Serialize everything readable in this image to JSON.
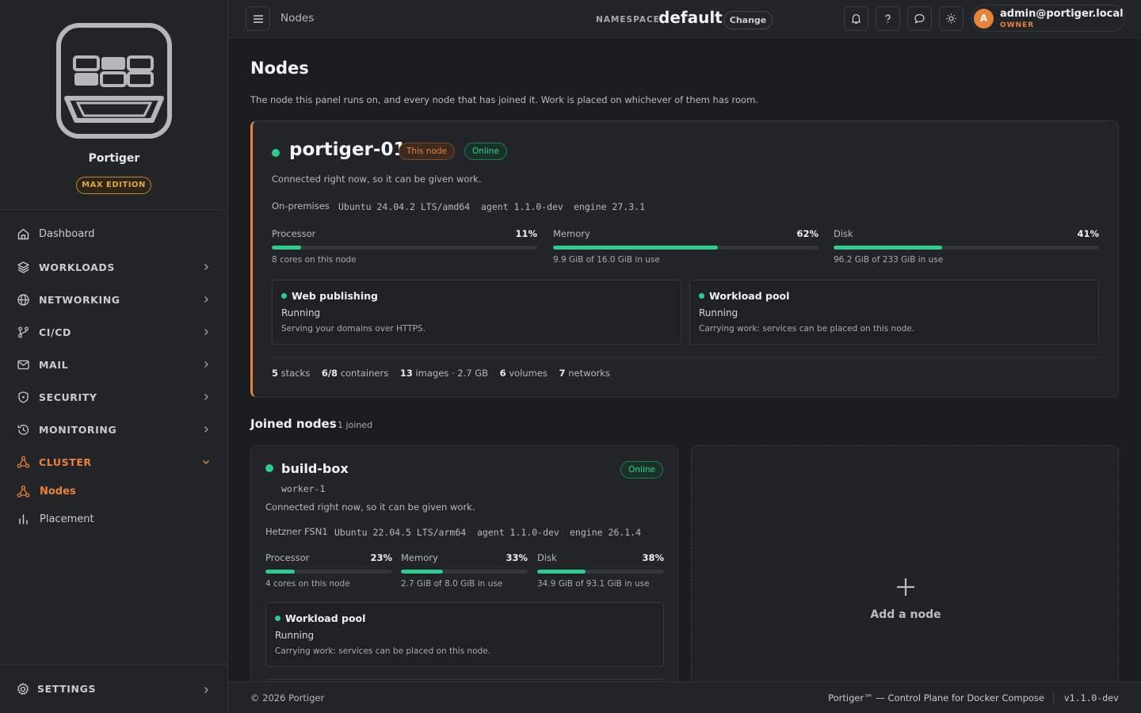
{
  "brand": {
    "name": "Portiger",
    "edition": "MAX EDITION"
  },
  "sidebar": {
    "dashboard": "Dashboard",
    "sections": [
      "WORKLOADS",
      "NETWORKING",
      "CI/CD",
      "MAIL",
      "SECURITY",
      "MONITORING"
    ],
    "cluster": "CLUSTER",
    "cluster_items": [
      "Nodes",
      "Placement"
    ],
    "settings": "SETTINGS"
  },
  "topbar": {
    "breadcrumb": "Nodes",
    "namespace_label": "NAMESPACE",
    "namespace_value": "default",
    "change_label": "Change",
    "user_initial": "A",
    "user_email": "admin@portiger.local",
    "user_role": "OWNER"
  },
  "page": {
    "title": "Nodes",
    "description": "The node this panel runs on, and every node that has joined it. Work is placed on whichever of them has room."
  },
  "local_node": {
    "name": "portiger-01",
    "this_badge": "This node",
    "status": "Online",
    "status_text": "Connected right now, so it can be given work.",
    "location": "On-premises",
    "os": "Ubuntu 24.04.2 LTS/amd64",
    "agent": "agent 1.1.0-dev",
    "engine": "engine 27.3.1",
    "resources": [
      {
        "label": "Processor",
        "pct_text": "11%",
        "pct": 11,
        "sub": "8 cores on this node"
      },
      {
        "label": "Memory",
        "pct_text": "62%",
        "pct": 62,
        "sub": "9.9 GiB of 16.0 GiB in use"
      },
      {
        "label": "Disk",
        "pct_text": "41%",
        "pct": 41,
        "sub": "96.2 GiB of 233 GiB in use"
      }
    ],
    "services": [
      {
        "title": "Web publishing",
        "state": "Running",
        "desc": "Serving your domains over HTTPS."
      },
      {
        "title": "Workload pool",
        "state": "Running",
        "desc": "Carrying work: services can be placed on this node."
      }
    ],
    "stats": {
      "stacks_n": "5",
      "stacks_l": "stacks",
      "containers_n": "6/8",
      "containers_l": "containers",
      "images_n": "13",
      "images_l": "images · 2.7 GB",
      "volumes_n": "6",
      "volumes_l": "volumes",
      "networks_n": "7",
      "networks_l": "networks"
    }
  },
  "joined": {
    "title": "Joined nodes",
    "count": "1 joined",
    "nodes": [
      {
        "name": "build-box",
        "role": "worker-1",
        "status": "Online",
        "status_text": "Connected right now, so it can be given work.",
        "location": "Hetzner FSN1",
        "os": "Ubuntu 22.04.5 LTS/arm64",
        "agent": "agent 1.1.0-dev",
        "engine": "engine 26.1.4",
        "resources": [
          {
            "label": "Processor",
            "pct_text": "23%",
            "pct": 23,
            "sub": "4 cores on this node"
          },
          {
            "label": "Memory",
            "pct_text": "33%",
            "pct": 33,
            "sub": "2.7 GiB of 8.0 GiB in use"
          },
          {
            "label": "Disk",
            "pct_text": "38%",
            "pct": 38,
            "sub": "34.9 GiB of 93.1 GiB in use"
          }
        ],
        "services": [
          {
            "title": "Workload pool",
            "state": "Running",
            "desc": "Carrying work: services can be placed on this node."
          }
        ]
      }
    ],
    "add_label": "Add a node"
  },
  "footer": {
    "copyright": "© 2026 Portiger",
    "tagline": "Portiger™ — Control Plane for Docker Compose",
    "version": "v1.1.0-dev"
  },
  "colors": {
    "accent": "#e8833a",
    "online": "#2ecc8f",
    "edition": "#e0a640"
  }
}
